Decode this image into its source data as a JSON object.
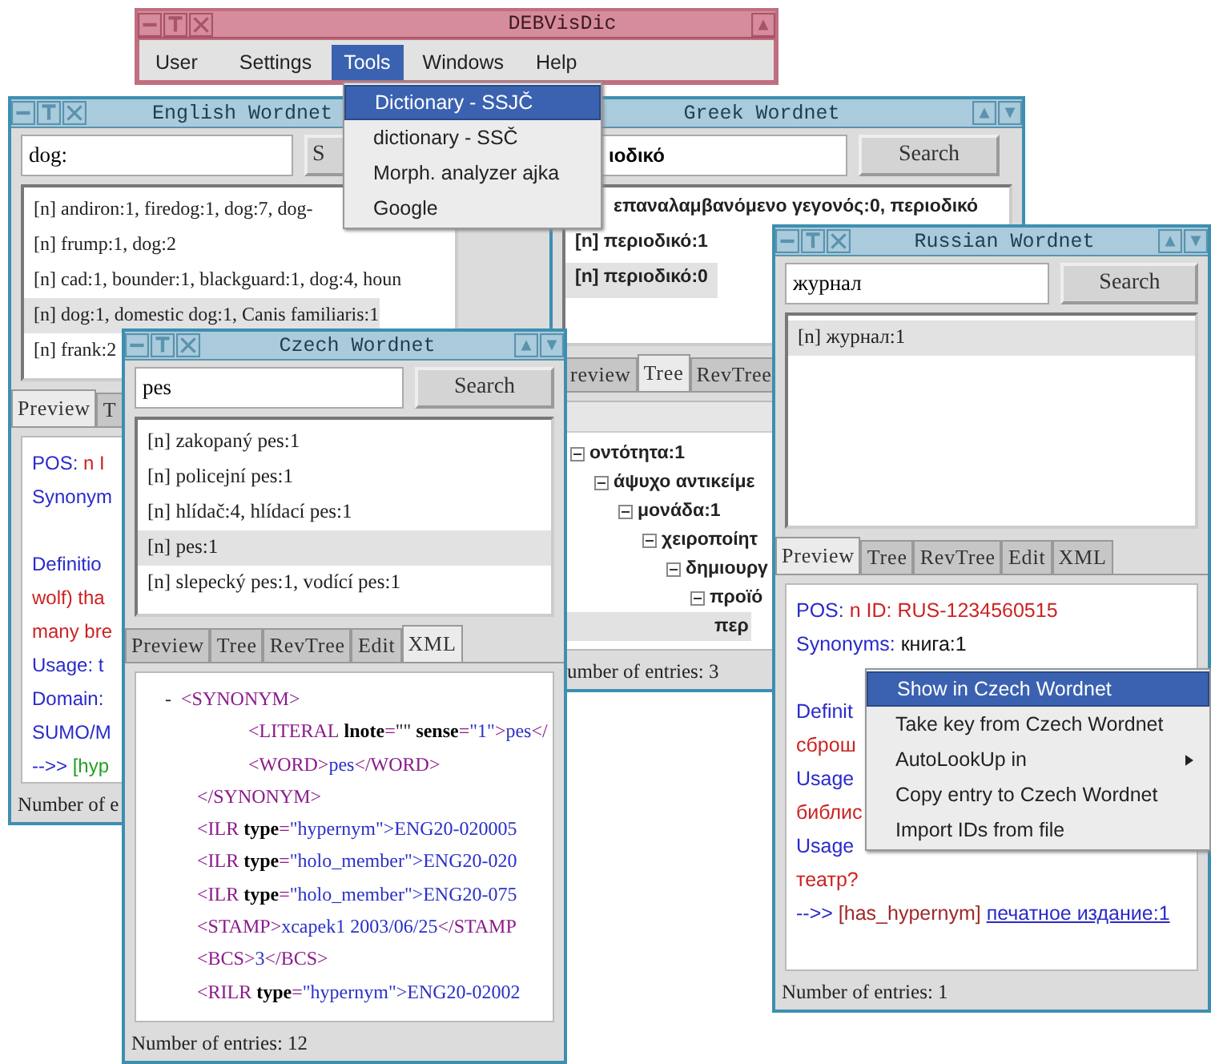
{
  "main_window": {
    "title": "DEBVisDic",
    "menu": [
      {
        "label": "User",
        "selected": false
      },
      {
        "label": "Settings",
        "selected": false
      },
      {
        "label": "Tools",
        "selected": true
      },
      {
        "label": "Windows",
        "selected": false
      },
      {
        "label": "Help",
        "selected": false
      }
    ]
  },
  "wordnet_windows": [
    {
      "title": "English Wordnet",
      "kind": "preview",
      "search": {
        "value": "dog:"
      },
      "search_button": "S",
      "entries": [
        {
          "text": "[n] andiron:1, firedog:1, dog:7, dog-",
          "selected": false
        },
        {
          "text": "[n] frump:1, dog:2",
          "selected": false
        },
        {
          "text": "[n] cad:1, bounder:1, blackguard:1, dog:4, houn",
          "selected": false
        },
        {
          "text": "[n] dog:1, domestic dog:1, Canis familiaris:1",
          "selected": true
        },
        {
          "text": "[n] frank:2",
          "selected": false
        }
      ],
      "tabs": [
        {
          "label": "Preview",
          "selected": true
        },
        {
          "label": "T",
          "selected": false
        }
      ],
      "preview": [
        {
          "lines": [
            {
              "segments": [
                {
                  "kind": "label",
                  "text": "POS:"
                },
                {
                  "kind": "value",
                  "text": " n I"
                }
              ]
            },
            {
              "segments": [
                {
                  "kind": "label",
                  "text": "Synonym"
                }
              ]
            }
          ]
        },
        {
          "lines": [
            {
              "segments": [
                {
                  "kind": "label",
                  "text": "Definitio"
                }
              ]
            },
            {
              "segments": [
                {
                  "kind": "value",
                  "text": "wolf) tha"
                }
              ]
            },
            {
              "segments": [
                {
                  "kind": "value",
                  "text": "many bre"
                }
              ]
            },
            {
              "segments": [
                {
                  "kind": "label",
                  "text": "Usage: t"
                }
              ]
            },
            {
              "segments": [
                {
                  "kind": "label",
                  "text": "Domain:"
                }
              ]
            },
            {
              "segments": [
                {
                  "kind": "label",
                  "text": "SUMO/M"
                }
              ]
            },
            {
              "segments": [
                {
                  "kind": "label",
                  "text": "-->>"
                },
                {
                  "kind": "relation",
                  "text": " [hyp"
                }
              ]
            }
          ]
        }
      ],
      "status": "Number of e"
    },
    {
      "title": "Greek Wordnet",
      "kind": "tree",
      "search": {
        "value": "ιοδικό"
      },
      "search_button": "Search",
      "entries": [
        {
          "text": "επαναλαμβανόμενο γεγονός:0, περιοδικό",
          "selected": false
        },
        {
          "text": "[n] περιοδικό:1",
          "selected": false
        },
        {
          "text": "[n] περιοδικό:0",
          "selected": true
        }
      ],
      "tabs": [
        {
          "label": "review",
          "selected": false
        },
        {
          "label": "Tree",
          "selected": true
        },
        {
          "label": "RevTree",
          "selected": false
        }
      ],
      "tree": [
        {
          "text": "οντότητα:1",
          "expanded": true,
          "selected": false,
          "children": [
            {
              "text": "άψυχο αντικείμε",
              "expanded": true,
              "selected": false,
              "children": [
                {
                  "text": "μονάδα:1",
                  "expanded": true,
                  "selected": false,
                  "children": [
                    {
                      "text": "χειροποίητ",
                      "expanded": true,
                      "selected": false,
                      "children": [
                        {
                          "text": "δημιουργ",
                          "expanded": true,
                          "selected": false,
                          "children": [
                            {
                              "text": "προϊό",
                              "expanded": true,
                              "selected": false,
                              "children": [
                                {
                                  "text": "περ",
                                  "selected": true
                                }
                              ]
                            }
                          ]
                        }
                      ]
                    }
                  ]
                }
              ]
            }
          ]
        }
      ],
      "status": "umber of entries: 3"
    },
    {
      "title": "Czech Wordnet",
      "kind": "xml",
      "search": {
        "value": "pes"
      },
      "search_button": "Search",
      "entries": [
        {
          "text": "[n] zakopaný pes:1",
          "selected": false
        },
        {
          "text": "[n] policejní pes:1",
          "selected": false
        },
        {
          "text": "[n] hlídač:4, hlídací pes:1",
          "selected": false
        },
        {
          "text": "[n] pes:1",
          "selected": true
        },
        {
          "text": "[n] slepecký pes:1, vodící pes:1",
          "selected": false
        }
      ],
      "tabs": [
        {
          "label": "Preview",
          "selected": false
        },
        {
          "label": "Tree",
          "selected": false
        },
        {
          "label": "RevTree",
          "selected": false
        },
        {
          "label": "Edit",
          "selected": false
        },
        {
          "label": "XML",
          "selected": true
        }
      ],
      "xml": [
        {
          "segments": [
            {
              "kind": "marker",
              "text": "-"
            },
            {
              "kind": "tag",
              "text": "<SYNONYM>"
            }
          ],
          "children": [
            {
              "segments": [
                {
                  "kind": "tag",
                  "text": "<LITERAL"
                },
                {
                  "kind": "attr",
                  "text": " lnote"
                },
                {
                  "kind": "tag",
                  "text": "="
                },
                {
                  "kind": "text",
                  "text": "\"\""
                },
                {
                  "kind": "attr",
                  "text": " sense"
                },
                {
                  "kind": "tag",
                  "text": "="
                },
                {
                  "kind": "value",
                  "text": "\"1\""
                },
                {
                  "kind": "tag",
                  "text": ">"
                },
                {
                  "kind": "value",
                  "text": "pes"
                },
                {
                  "kind": "tag",
                  "text": "</"
                }
              ]
            },
            {
              "segments": [
                {
                  "kind": "tag",
                  "text": "<WORD>"
                },
                {
                  "kind": "value",
                  "text": "pes"
                },
                {
                  "kind": "tag",
                  "text": "</WORD>"
                }
              ]
            }
          ],
          "closing": [
            {
              "kind": "tag",
              "text": "</SYNONYM>"
            }
          ]
        },
        {
          "segments": [
            {
              "kind": "tag",
              "text": "<ILR"
            },
            {
              "kind": "attr",
              "text": " type"
            },
            {
              "kind": "tag",
              "text": "="
            },
            {
              "kind": "value",
              "text": "\"hypernym\">ENG20-020005"
            }
          ]
        },
        {
          "segments": [
            {
              "kind": "tag",
              "text": "<ILR"
            },
            {
              "kind": "attr",
              "text": " type"
            },
            {
              "kind": "tag",
              "text": "="
            },
            {
              "kind": "value",
              "text": "\"holo_member\">ENG20-020"
            }
          ]
        },
        {
          "segments": [
            {
              "kind": "tag",
              "text": "<ILR"
            },
            {
              "kind": "attr",
              "text": " type"
            },
            {
              "kind": "tag",
              "text": "="
            },
            {
              "kind": "value",
              "text": "\"holo_member\">ENG20-075"
            }
          ]
        },
        {
          "segments": [
            {
              "kind": "tag",
              "text": "<STAMP>"
            },
            {
              "kind": "value",
              "text": "xcapek1 2003/06/25"
            },
            {
              "kind": "tag",
              "text": "</STAMP"
            }
          ]
        },
        {
          "segments": [
            {
              "kind": "tag",
              "text": "<BCS>"
            },
            {
              "kind": "value",
              "text": "3"
            },
            {
              "kind": "tag",
              "text": "</BCS>"
            }
          ]
        },
        {
          "segments": [
            {
              "kind": "tag",
              "text": "<RILR"
            },
            {
              "kind": "attr",
              "text": " type"
            },
            {
              "kind": "tag",
              "text": "="
            },
            {
              "kind": "value",
              "text": "\"hypernym\">ENG20-02002"
            }
          ]
        }
      ],
      "status": "Number of entries: 12"
    },
    {
      "title": "Russian Wordnet",
      "kind": "preview",
      "search": {
        "value": "журнал"
      },
      "search_button": "Search",
      "entries": [
        {
          "text": "[n] журнал:1",
          "selected": true
        }
      ],
      "tabs": [
        {
          "label": "Preview",
          "selected": true
        },
        {
          "label": "Tree",
          "selected": false
        },
        {
          "label": "RevTree",
          "selected": false
        },
        {
          "label": "Edit",
          "selected": false
        },
        {
          "label": "XML",
          "selected": false
        }
      ],
      "preview": [
        {
          "lines": [
            {
              "segments": [
                {
                  "kind": "label",
                  "text": "POS:"
                },
                {
                  "kind": "value",
                  "text": " n ID: RUS-1234560515"
                }
              ]
            },
            {
              "segments": [
                {
                  "kind": "label",
                  "text": "Synonyms:"
                },
                {
                  "kind": "text",
                  "text": " книга:1"
                }
              ]
            }
          ]
        },
        {
          "lines": [
            {
              "segments": [
                {
                  "kind": "label",
                  "text": "Definit"
                }
              ]
            },
            {
              "segments": [
                {
                  "kind": "value",
                  "text": "сброш"
                }
              ]
            },
            {
              "segments": [
                {
                  "kind": "label",
                  "text": "Usage"
                }
              ]
            },
            {
              "segments": [
                {
                  "kind": "value",
                  "text": "библис"
                }
              ]
            },
            {
              "segments": [
                {
                  "kind": "label",
                  "text": "Usage"
                }
              ]
            },
            {
              "segments": [
                {
                  "kind": "value",
                  "text": "театр?"
                }
              ]
            },
            {
              "segments": [
                {
                  "kind": "label",
                  "text": "-->>"
                },
                {
                  "kind": "role",
                  "text": " [has_hypernym] "
                },
                {
                  "kind": "link",
                  "text": "печатное издание:1"
                }
              ]
            }
          ]
        }
      ],
      "status": "Number of entries: 1"
    }
  ],
  "tools_menu": {
    "items": [
      {
        "label": "Dictionary - SSJČ",
        "selected": true
      },
      {
        "label": "dictionary - SSČ",
        "selected": false
      },
      {
        "label": "Morph. analyzer ajka",
        "selected": false
      },
      {
        "label": "Google",
        "selected": false
      }
    ]
  },
  "context_menu": {
    "items": [
      {
        "label": "Show in Czech Wordnet",
        "selected": true,
        "kind": "action"
      },
      {
        "label": "Take key from Czech Wordnet",
        "selected": false,
        "kind": "action"
      },
      {
        "label": "AutoLookUp in",
        "selected": false,
        "kind": "submenu"
      },
      {
        "label": "Copy entry to Czech Wordnet",
        "selected": false,
        "kind": "action"
      },
      {
        "label": "Import IDs from file",
        "selected": false,
        "kind": "action"
      }
    ]
  }
}
